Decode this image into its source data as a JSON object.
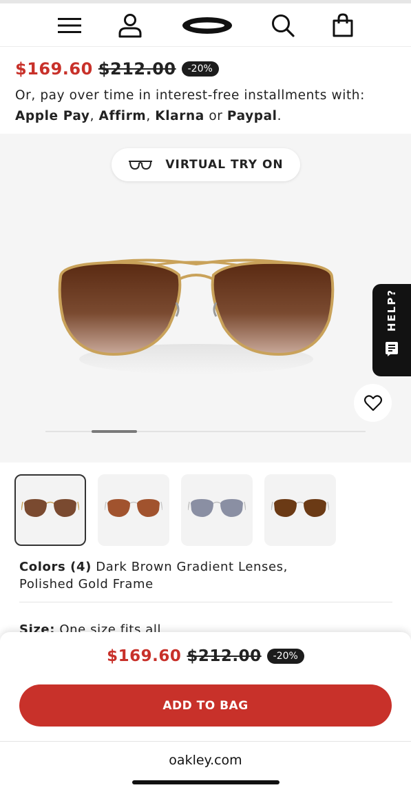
{
  "header": {
    "icons": [
      "menu-icon",
      "account-icon",
      "oakley-logo",
      "search-icon",
      "bag-icon"
    ]
  },
  "pricing": {
    "sale_price": "$169.60",
    "original_price": "$212.00",
    "discount": "-20%"
  },
  "installments": {
    "intro": "Or, pay over time in interest-free installments with:",
    "apple_pay": "Apple Pay",
    "affirm": "Affirm",
    "klarna": "Klarna",
    "or": "or",
    "paypal": "Paypal",
    "sep": ",",
    "end": "."
  },
  "hero": {
    "virtual_try_on": "VIRTUAL TRY ON",
    "help": "HELP?"
  },
  "thumbnails": [
    {
      "label": "Dark Brown Gradient Lenses, Polished Gold Frame",
      "selected": true
    },
    {
      "label": "variant-2",
      "selected": false
    },
    {
      "label": "variant-3",
      "selected": false
    },
    {
      "label": "variant-4",
      "selected": false
    }
  ],
  "product": {
    "colors_label": "Colors (4)",
    "color_name": "Dark Brown Gradient Lenses, Polished Gold Frame",
    "size_label": "Size:",
    "size_value": "One size fits all"
  },
  "sheet": {
    "sale_price": "$169.60",
    "original_price": "$212.00",
    "discount": "-20%",
    "add_to_bag": "ADD TO BAG"
  },
  "browser": {
    "url": "oakley.com"
  },
  "colors": {
    "accent_red": "#c8312a",
    "dark": "#1c1c1c"
  }
}
